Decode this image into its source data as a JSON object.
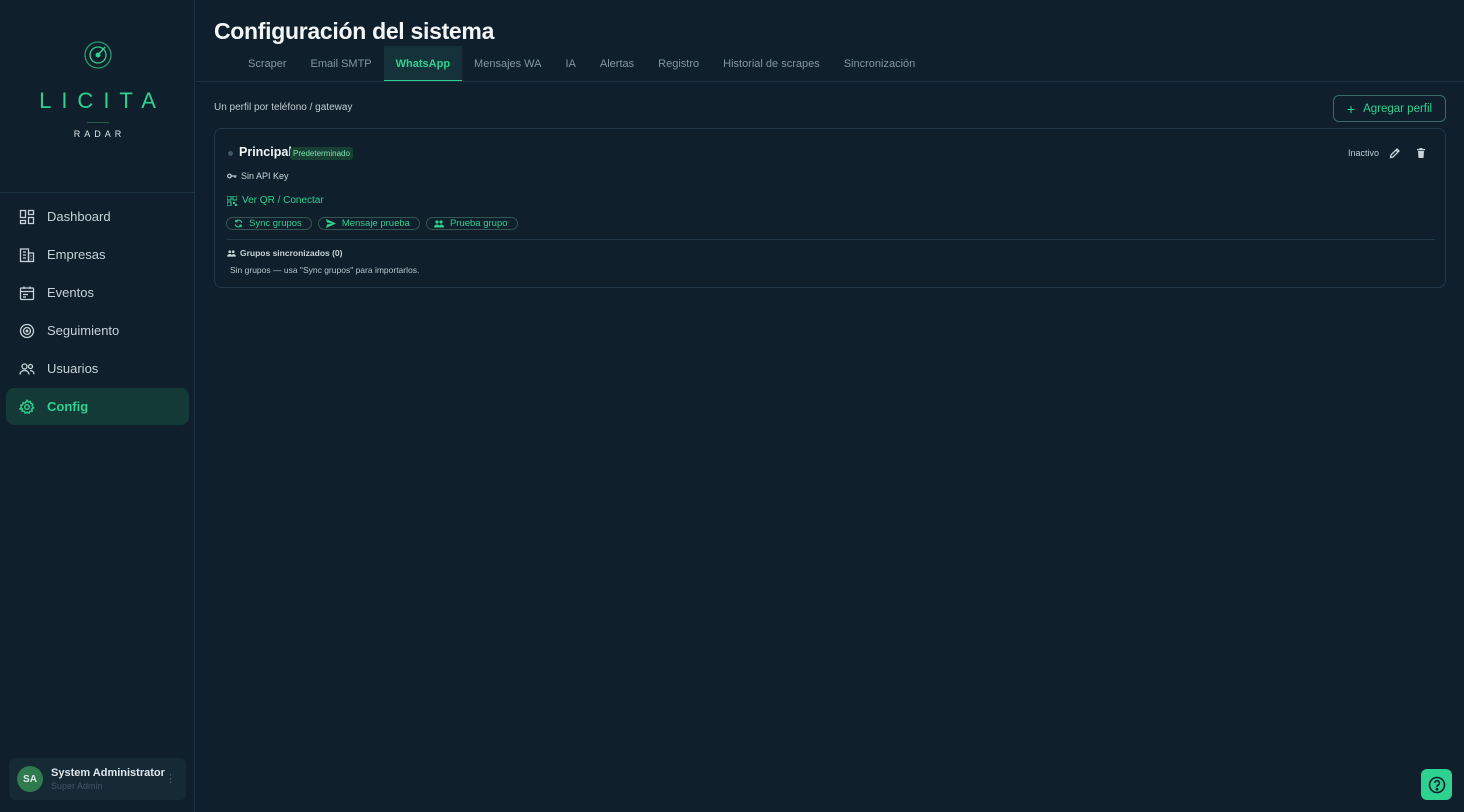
{
  "brand": {
    "name": "LICITA",
    "tagline": "RADAR"
  },
  "sidebar": {
    "items": [
      {
        "label": "Dashboard",
        "icon": "dashboard-icon"
      },
      {
        "label": "Empresas",
        "icon": "building-icon"
      },
      {
        "label": "Eventos",
        "icon": "calendar-icon"
      },
      {
        "label": "Seguimiento",
        "icon": "radar-icon"
      },
      {
        "label": "Usuarios",
        "icon": "users-icon"
      },
      {
        "label": "Config",
        "icon": "gear-icon",
        "active": true
      }
    ],
    "user": {
      "initials": "SA",
      "name": "System Administrator",
      "role": "Super Admin"
    }
  },
  "header": {
    "title": "Configuración del sistema",
    "tabs": [
      {
        "label": "Scraper"
      },
      {
        "label": "Email SMTP"
      },
      {
        "label": "WhatsApp",
        "active": true
      },
      {
        "label": "Mensajes WA"
      },
      {
        "label": "IA"
      },
      {
        "label": "Alertas"
      },
      {
        "label": "Registro"
      },
      {
        "label": "Historial de scrapes"
      },
      {
        "label": "Sincronización"
      }
    ]
  },
  "main": {
    "subtitle": "Un perfil por teléfono / gateway",
    "add_button": "Agregar perfil",
    "profile": {
      "name": "Principal",
      "badge": "Predeterminado",
      "status": "Inactivo",
      "api_key": "Sin API Key",
      "qr_link": "Ver QR / Conectar",
      "actions": [
        "Sync grupos",
        "Mensaje prueba",
        "Prueba grupo"
      ],
      "groups_title": "Grupos sincronizados (0)",
      "groups_empty": "Sin grupos — usa \"Sync grupos\" para importarlos."
    }
  },
  "colors": {
    "accent": "#2fd191",
    "background": "#0f1f2b",
    "active_nav": "#133a36"
  }
}
